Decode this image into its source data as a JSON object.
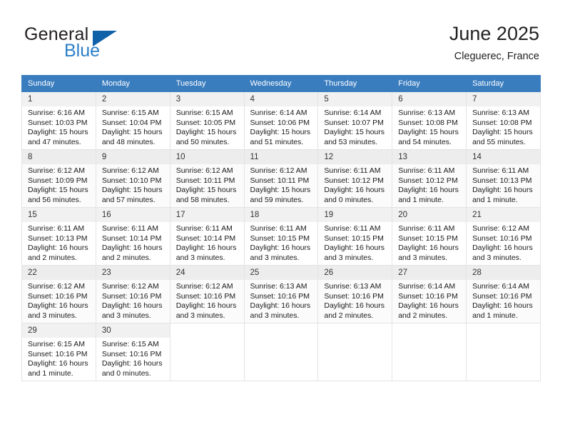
{
  "brand": {
    "word_one": "General",
    "word_two": "Blue",
    "flag_icon": "triangle-flag-icon"
  },
  "header": {
    "title": "June 2025",
    "location": "Cleguerec, France"
  },
  "colors": {
    "header_blue": "#3a7dbf",
    "brand_blue": "#2a7fc9",
    "logo_flag_blue": "#1061a8",
    "daynum_bg": "#f1f1f1",
    "row_alt_bg": "#fbfbfb"
  },
  "weekdays": [
    "Sunday",
    "Monday",
    "Tuesday",
    "Wednesday",
    "Thursday",
    "Friday",
    "Saturday"
  ],
  "weeks": [
    {
      "alt": false,
      "days": [
        {
          "num": "1",
          "sunrise": "Sunrise: 6:16 AM",
          "sunset": "Sunset: 10:03 PM",
          "daylight_1": "Daylight: 15 hours",
          "daylight_2": "and 47 minutes."
        },
        {
          "num": "2",
          "sunrise": "Sunrise: 6:15 AM",
          "sunset": "Sunset: 10:04 PM",
          "daylight_1": "Daylight: 15 hours",
          "daylight_2": "and 48 minutes."
        },
        {
          "num": "3",
          "sunrise": "Sunrise: 6:15 AM",
          "sunset": "Sunset: 10:05 PM",
          "daylight_1": "Daylight: 15 hours",
          "daylight_2": "and 50 minutes."
        },
        {
          "num": "4",
          "sunrise": "Sunrise: 6:14 AM",
          "sunset": "Sunset: 10:06 PM",
          "daylight_1": "Daylight: 15 hours",
          "daylight_2": "and 51 minutes."
        },
        {
          "num": "5",
          "sunrise": "Sunrise: 6:14 AM",
          "sunset": "Sunset: 10:07 PM",
          "daylight_1": "Daylight: 15 hours",
          "daylight_2": "and 53 minutes."
        },
        {
          "num": "6",
          "sunrise": "Sunrise: 6:13 AM",
          "sunset": "Sunset: 10:08 PM",
          "daylight_1": "Daylight: 15 hours",
          "daylight_2": "and 54 minutes."
        },
        {
          "num": "7",
          "sunrise": "Sunrise: 6:13 AM",
          "sunset": "Sunset: 10:08 PM",
          "daylight_1": "Daylight: 15 hours",
          "daylight_2": "and 55 minutes."
        }
      ]
    },
    {
      "alt": true,
      "days": [
        {
          "num": "8",
          "sunrise": "Sunrise: 6:12 AM",
          "sunset": "Sunset: 10:09 PM",
          "daylight_1": "Daylight: 15 hours",
          "daylight_2": "and 56 minutes."
        },
        {
          "num": "9",
          "sunrise": "Sunrise: 6:12 AM",
          "sunset": "Sunset: 10:10 PM",
          "daylight_1": "Daylight: 15 hours",
          "daylight_2": "and 57 minutes."
        },
        {
          "num": "10",
          "sunrise": "Sunrise: 6:12 AM",
          "sunset": "Sunset: 10:11 PM",
          "daylight_1": "Daylight: 15 hours",
          "daylight_2": "and 58 minutes."
        },
        {
          "num": "11",
          "sunrise": "Sunrise: 6:12 AM",
          "sunset": "Sunset: 10:11 PM",
          "daylight_1": "Daylight: 15 hours",
          "daylight_2": "and 59 minutes."
        },
        {
          "num": "12",
          "sunrise": "Sunrise: 6:11 AM",
          "sunset": "Sunset: 10:12 PM",
          "daylight_1": "Daylight: 16 hours",
          "daylight_2": "and 0 minutes."
        },
        {
          "num": "13",
          "sunrise": "Sunrise: 6:11 AM",
          "sunset": "Sunset: 10:12 PM",
          "daylight_1": "Daylight: 16 hours",
          "daylight_2": "and 1 minute."
        },
        {
          "num": "14",
          "sunrise": "Sunrise: 6:11 AM",
          "sunset": "Sunset: 10:13 PM",
          "daylight_1": "Daylight: 16 hours",
          "daylight_2": "and 1 minute."
        }
      ]
    },
    {
      "alt": false,
      "days": [
        {
          "num": "15",
          "sunrise": "Sunrise: 6:11 AM",
          "sunset": "Sunset: 10:13 PM",
          "daylight_1": "Daylight: 16 hours",
          "daylight_2": "and 2 minutes."
        },
        {
          "num": "16",
          "sunrise": "Sunrise: 6:11 AM",
          "sunset": "Sunset: 10:14 PM",
          "daylight_1": "Daylight: 16 hours",
          "daylight_2": "and 2 minutes."
        },
        {
          "num": "17",
          "sunrise": "Sunrise: 6:11 AM",
          "sunset": "Sunset: 10:14 PM",
          "daylight_1": "Daylight: 16 hours",
          "daylight_2": "and 3 minutes."
        },
        {
          "num": "18",
          "sunrise": "Sunrise: 6:11 AM",
          "sunset": "Sunset: 10:15 PM",
          "daylight_1": "Daylight: 16 hours",
          "daylight_2": "and 3 minutes."
        },
        {
          "num": "19",
          "sunrise": "Sunrise: 6:11 AM",
          "sunset": "Sunset: 10:15 PM",
          "daylight_1": "Daylight: 16 hours",
          "daylight_2": "and 3 minutes."
        },
        {
          "num": "20",
          "sunrise": "Sunrise: 6:11 AM",
          "sunset": "Sunset: 10:15 PM",
          "daylight_1": "Daylight: 16 hours",
          "daylight_2": "and 3 minutes."
        },
        {
          "num": "21",
          "sunrise": "Sunrise: 6:12 AM",
          "sunset": "Sunset: 10:16 PM",
          "daylight_1": "Daylight: 16 hours",
          "daylight_2": "and 3 minutes."
        }
      ]
    },
    {
      "alt": true,
      "days": [
        {
          "num": "22",
          "sunrise": "Sunrise: 6:12 AM",
          "sunset": "Sunset: 10:16 PM",
          "daylight_1": "Daylight: 16 hours",
          "daylight_2": "and 3 minutes."
        },
        {
          "num": "23",
          "sunrise": "Sunrise: 6:12 AM",
          "sunset": "Sunset: 10:16 PM",
          "daylight_1": "Daylight: 16 hours",
          "daylight_2": "and 3 minutes."
        },
        {
          "num": "24",
          "sunrise": "Sunrise: 6:12 AM",
          "sunset": "Sunset: 10:16 PM",
          "daylight_1": "Daylight: 16 hours",
          "daylight_2": "and 3 minutes."
        },
        {
          "num": "25",
          "sunrise": "Sunrise: 6:13 AM",
          "sunset": "Sunset: 10:16 PM",
          "daylight_1": "Daylight: 16 hours",
          "daylight_2": "and 3 minutes."
        },
        {
          "num": "26",
          "sunrise": "Sunrise: 6:13 AM",
          "sunset": "Sunset: 10:16 PM",
          "daylight_1": "Daylight: 16 hours",
          "daylight_2": "and 2 minutes."
        },
        {
          "num": "27",
          "sunrise": "Sunrise: 6:14 AM",
          "sunset": "Sunset: 10:16 PM",
          "daylight_1": "Daylight: 16 hours",
          "daylight_2": "and 2 minutes."
        },
        {
          "num": "28",
          "sunrise": "Sunrise: 6:14 AM",
          "sunset": "Sunset: 10:16 PM",
          "daylight_1": "Daylight: 16 hours",
          "daylight_2": "and 1 minute."
        }
      ]
    },
    {
      "alt": false,
      "days": [
        {
          "num": "29",
          "sunrise": "Sunrise: 6:15 AM",
          "sunset": "Sunset: 10:16 PM",
          "daylight_1": "Daylight: 16 hours",
          "daylight_2": "and 1 minute."
        },
        {
          "num": "30",
          "sunrise": "Sunrise: 6:15 AM",
          "sunset": "Sunset: 10:16 PM",
          "daylight_1": "Daylight: 16 hours",
          "daylight_2": "and 0 minutes."
        },
        {
          "num": "",
          "sunrise": "",
          "sunset": "",
          "daylight_1": "",
          "daylight_2": ""
        },
        {
          "num": "",
          "sunrise": "",
          "sunset": "",
          "daylight_1": "",
          "daylight_2": ""
        },
        {
          "num": "",
          "sunrise": "",
          "sunset": "",
          "daylight_1": "",
          "daylight_2": ""
        },
        {
          "num": "",
          "sunrise": "",
          "sunset": "",
          "daylight_1": "",
          "daylight_2": ""
        },
        {
          "num": "",
          "sunrise": "",
          "sunset": "",
          "daylight_1": "",
          "daylight_2": ""
        }
      ]
    }
  ]
}
